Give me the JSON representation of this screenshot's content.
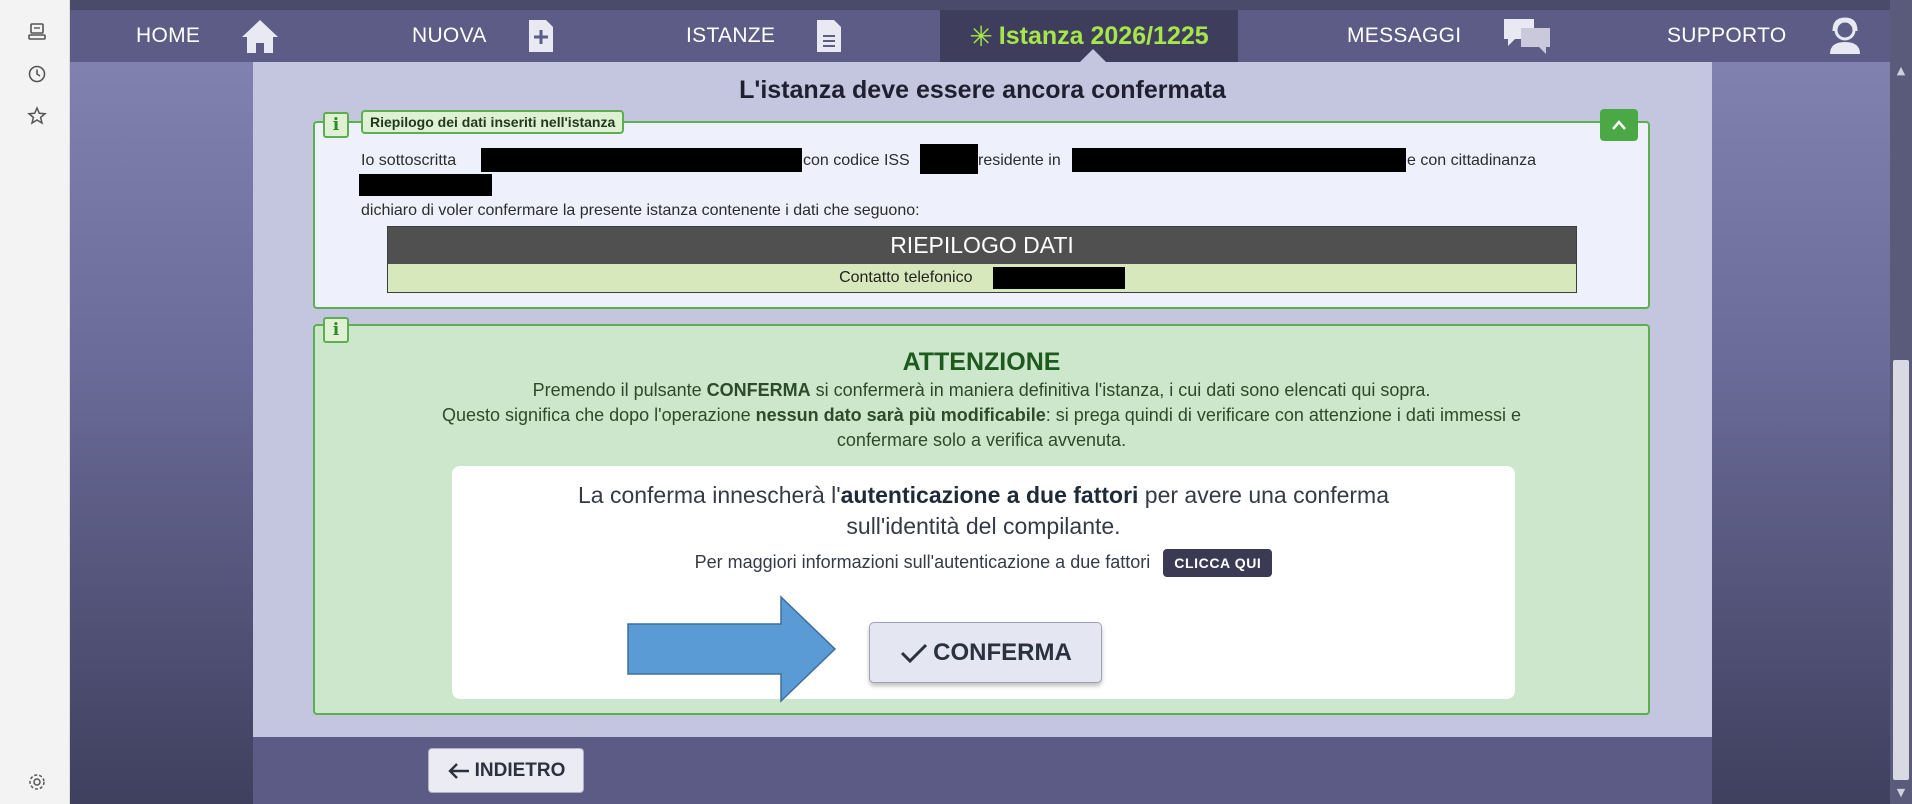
{
  "rail": {
    "icons": [
      "device-icon",
      "history-icon",
      "favorites-icon",
      "settings-icon"
    ]
  },
  "nav": {
    "items": [
      {
        "label": "HOME",
        "icon": "home-icon"
      },
      {
        "label": "NUOVA",
        "icon": "new-document-icon"
      },
      {
        "label": "ISTANZE",
        "icon": "document-icon"
      },
      {
        "label": "MESSAGGI",
        "icon": "chat-icon"
      },
      {
        "label": "SUPPORTO",
        "icon": "support-icon"
      }
    ],
    "current": {
      "star": "✳",
      "label": "Istanza 2026/1225"
    }
  },
  "panel": {
    "title": "L'istanza deve essere ancora confermata"
  },
  "recap": {
    "legend": "Riepilogo dei dati inseriti nell'istanza",
    "badge": "i",
    "collapse": "^",
    "line1_a": "Io sottoscritta",
    "line1_b": "con codice ISS",
    "line1_c": "residente in",
    "line1_d": "e con cittadinanza",
    "line2": "dichiaro di voler confermare la presente istanza contenente i dati che seguono:",
    "table_header": "RIEPILOGO DATI",
    "row_label": "Contatto telefonico"
  },
  "attention": {
    "badge": "i",
    "title": "ATTENZIONE",
    "p1_a": "Premendo il pulsante ",
    "p1_b": "CONFERMA",
    "p1_c": " si confermerà in maniera definitiva l'istanza, i cui dati sono elencati qui sopra.",
    "p2_a": "Questo significa che dopo l'operazione ",
    "p2_b": "nessun dato sarà più modificabile",
    "p2_c": ": si prega quindi di verificare con attenzione i dati immessi e",
    "p3": "confermare solo a verifica avvenuta.",
    "twofa_a": "La conferma innescherà l'",
    "twofa_b": "autenticazione a due fattori",
    "twofa_c": " per avere una conferma",
    "twofa_d": "sull'identità del compilante.",
    "moreinfo": "Per maggiori informazioni sull'autenticazione a due fattori",
    "clicca": "CLICCA QUI",
    "confirm_label": "CONFERMA",
    "colors": {
      "arrow": "#5b9bd5",
      "accent": "#4aa845"
    }
  },
  "footer": {
    "back_label": "INDIETRO"
  }
}
